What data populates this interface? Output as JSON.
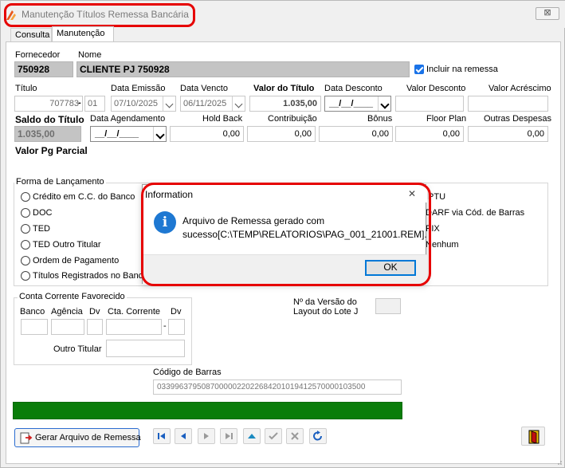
{
  "window": {
    "title": "Manutenção Títulos Remessa Bancária",
    "close_symbol": "⊠"
  },
  "tabs": [
    {
      "label": "Consulta"
    },
    {
      "label": "Manutenção"
    }
  ],
  "fornecedor": {
    "label": "Fornecedor",
    "value": "750928"
  },
  "nome": {
    "label": "Nome",
    "value": "CLIENTE PJ 750928"
  },
  "incluir_remessa": {
    "label": "Incluir na remessa",
    "checked": true
  },
  "titulo": {
    "label": "Título",
    "value": "707783",
    "separator": "-",
    "parcela": "01"
  },
  "data_emissao": {
    "label": "Data Emissão",
    "value": "07/10/2025"
  },
  "data_vencto": {
    "label": "Data Vencto",
    "value": "06/11/2025"
  },
  "valor_titulo": {
    "label": "Valor do Título",
    "value": "1.035,00"
  },
  "data_desconto": {
    "label": "Data Desconto",
    "value": "__/__/____"
  },
  "valor_desconto": {
    "label": "Valor Desconto",
    "value": ""
  },
  "valor_acrescimo": {
    "label": "Valor Acréscimo",
    "value": ""
  },
  "saldo_titulo": {
    "label": "Saldo do Título",
    "value": "1.035,00"
  },
  "data_agendamento": {
    "label": "Data Agendamento",
    "value": "__/__/____"
  },
  "hold_back": {
    "label": "Hold Back",
    "value": "0,00"
  },
  "contribuicao": {
    "label": "Contribuição",
    "value": "0,00"
  },
  "bonus": {
    "label": "Bônus",
    "value": "0,00"
  },
  "floor_plan": {
    "label": "Floor Plan",
    "value": "0,00"
  },
  "outras_despesas": {
    "label": "Outras Despesas",
    "value": "0,00"
  },
  "valor_pg_parcial": {
    "label": "Valor Pg Parcial"
  },
  "forma_lancamento": {
    "title": "Forma de Lançamento",
    "left_options": [
      "Crédito em C.C. do Banco",
      "DOC",
      "TED",
      "TED Outro Titular",
      "Ordem de Pagamento",
      "Títulos Registrados no Banco"
    ],
    "right_options": [
      "IPTU",
      "DARF via Cód. de Barras",
      "PIX",
      "Nenhum"
    ]
  },
  "conta_corrente": {
    "title": "Conta Corrente Favorecido",
    "banco_label": "Banco",
    "agencia_label": "Agência",
    "dv_label": "Dv",
    "cta_corrente_label": "Cta. Corrente",
    "dv2_label": "Dv",
    "dash": "-",
    "outro_titular_label": "Outro Titular"
  },
  "versao_layout": {
    "label_line1": "Nº da Versão do",
    "label_line2": "Layout do Lote J"
  },
  "codigo_barras": {
    "label": "Código de Barras",
    "value": "03399637950870000022022684201019412570000103500"
  },
  "actions": {
    "gerar_label": "Gerar Arquivo de Remessa"
  },
  "dialog": {
    "title": "Information",
    "close_symbol": "✕",
    "message_line1": "Arquivo de Remessa gerado com",
    "message_line2": "sucesso[C:\\TEMP\\RELATORIOS\\PAG_001_21001.REM].",
    "icon_glyph": "i",
    "ok_label": "OK"
  },
  "colors": {
    "highlight": "#e60000",
    "progress": "#0a7d0a",
    "info": "#1e78d2"
  }
}
